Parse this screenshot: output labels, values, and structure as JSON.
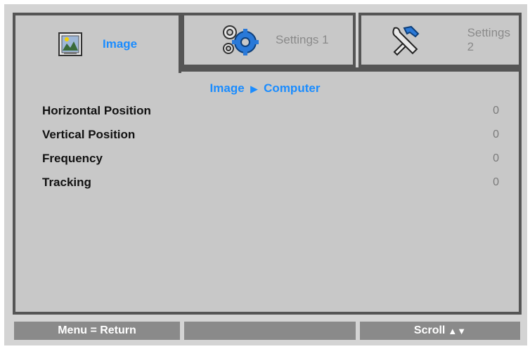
{
  "tabs": [
    {
      "label": "Image",
      "icon": "image-icon",
      "active": true
    },
    {
      "label": "Settings 1",
      "icon": "gears-icon",
      "active": false
    },
    {
      "label": "Settings 2",
      "icon": "tools-icon",
      "active": false
    }
  ],
  "breadcrumb": {
    "parent": "Image",
    "child": "Computer"
  },
  "rows": [
    {
      "label": "Horizontal Position",
      "value": "0"
    },
    {
      "label": "Vertical Position",
      "value": "0"
    },
    {
      "label": "Frequency",
      "value": "0"
    },
    {
      "label": "Tracking",
      "value": "0"
    }
  ],
  "footer": {
    "left": "Menu = Return",
    "middle": "",
    "right": "Scroll"
  },
  "colors": {
    "accent": "#1a8cff",
    "border": "#555555",
    "panel": "#c8c8c8",
    "footer": "#8a8a8a"
  }
}
